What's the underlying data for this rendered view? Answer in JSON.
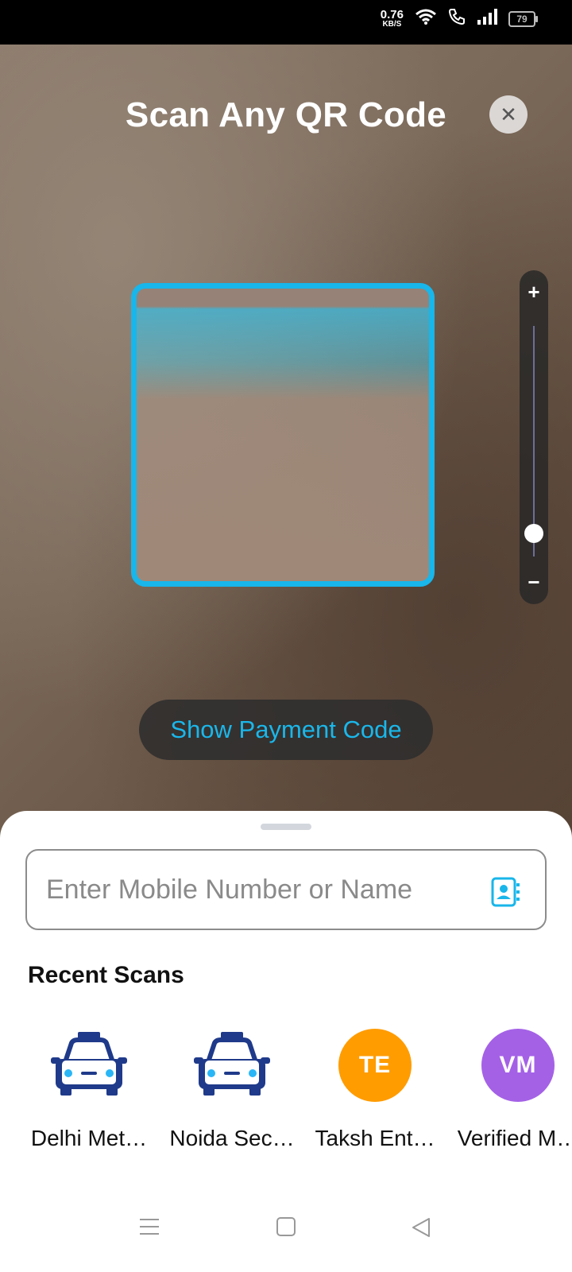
{
  "status_bar": {
    "net_speed_value": "0.76",
    "net_speed_unit": "KB/S",
    "battery": "79"
  },
  "scanner": {
    "title": "Scan Any QR Code",
    "close_icon": "close-icon",
    "zoom": {
      "plus": "+",
      "minus": "−",
      "level": 0.1
    },
    "payment_button": "Show Payment Code"
  },
  "sheet": {
    "search_placeholder": "Enter Mobile Number or Name",
    "recent_title": "Recent Scans",
    "recent": [
      {
        "label": "Delhi Met…",
        "icon": "taxi-icon"
      },
      {
        "label": "Noida Sec…",
        "icon": "taxi-icon"
      },
      {
        "label": "Taksh Ent…",
        "initials": "TE",
        "color": "#ff9c00"
      },
      {
        "label": "Verified M…",
        "initials": "VM",
        "color": "#a461e6"
      }
    ]
  },
  "colors": {
    "accent": "#18b6ea",
    "taxi": "#1f3a8a"
  }
}
